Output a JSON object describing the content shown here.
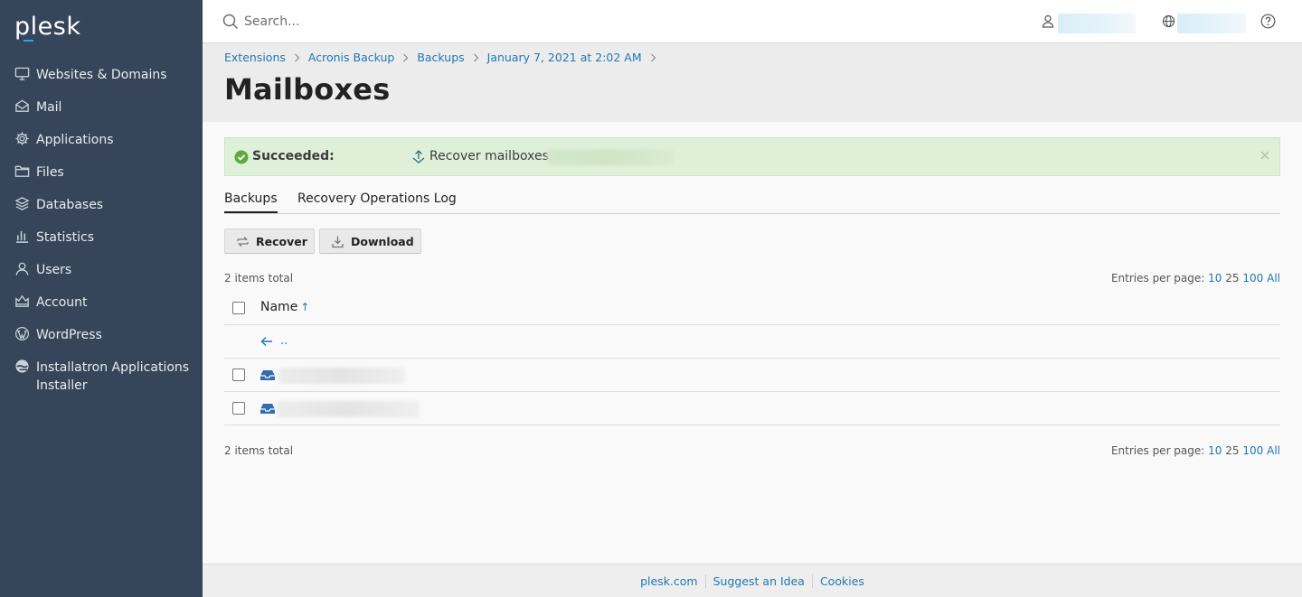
{
  "brand": {
    "logo_text": "plesk"
  },
  "sidebar": {
    "items": [
      {
        "label": "Websites & Domains",
        "icon": "monitor-icon"
      },
      {
        "label": "Mail",
        "icon": "envelope-icon"
      },
      {
        "label": "Applications",
        "icon": "gear-icon"
      },
      {
        "label": "Files",
        "icon": "folder-icon"
      },
      {
        "label": "Databases",
        "icon": "database-icon"
      },
      {
        "label": "Statistics",
        "icon": "bar-chart-icon"
      },
      {
        "label": "Users",
        "icon": "user-icon"
      },
      {
        "label": "Account",
        "icon": "account-icon"
      },
      {
        "label": "WordPress",
        "icon": "wordpress-icon"
      },
      {
        "label": "Installatron Applications Installer",
        "icon": "installatron-icon"
      }
    ]
  },
  "topbar": {
    "search_placeholder": "Search..."
  },
  "breadcrumb": [
    "Extensions",
    "Acronis Backup",
    "Backups",
    "January 7, 2021 at 2:02 AM"
  ],
  "page_title": "Mailboxes",
  "message": {
    "status": "Succeeded:",
    "text": "Recover mailboxes",
    "status_color": "#dff0d8"
  },
  "tabs": [
    {
      "label": "Backups",
      "active": true
    },
    {
      "label": "Recovery Operations Log",
      "active": false
    }
  ],
  "toolbar": {
    "recover_label": "Recover",
    "download_label": "Download"
  },
  "list": {
    "total_text": "2 items total",
    "per_page_label": "Entries per page:",
    "per_page_options": [
      "10",
      "25",
      "100",
      "All"
    ],
    "per_page_current": "25",
    "column_name": "Name",
    "sort_arrow": "↑",
    "up_label": ".."
  },
  "footer": {
    "links": [
      "plesk.com",
      "Suggest an Idea",
      "Cookies"
    ]
  },
  "colors": {
    "sidebar_bg": "#36455a",
    "link": "#2178b4",
    "accent": "#27a9e1",
    "success_bg": "#dff0d8"
  }
}
